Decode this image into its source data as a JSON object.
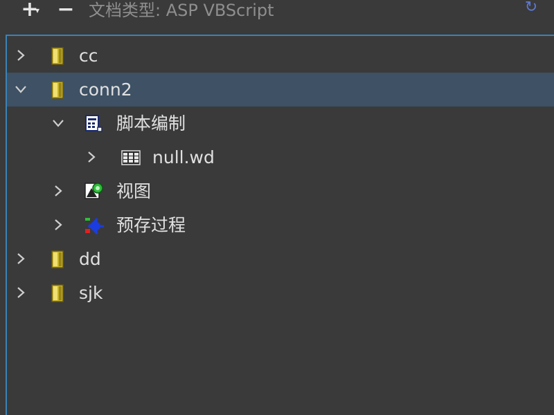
{
  "toolbar": {
    "add_icon": "plus-icon",
    "remove_icon": "minus-icon",
    "doc_type_label": "文档类型: ASP VBScript",
    "refresh_icon": "refresh-icon",
    "accent": "#3a83b8"
  },
  "tree": {
    "items": [
      {
        "label": "cc",
        "icon": "database-icon",
        "expanded": false,
        "level": 0
      },
      {
        "label": "conn2",
        "icon": "database-icon",
        "expanded": true,
        "selected": true,
        "level": 0
      },
      {
        "label": "脚本编制",
        "icon": "script-icon",
        "expanded": true,
        "level": 1
      },
      {
        "label": "null.wd",
        "icon": "table-icon",
        "expanded": false,
        "level": 2
      },
      {
        "label": "视图",
        "icon": "view-icon",
        "expanded": false,
        "level": 1
      },
      {
        "label": "预存过程",
        "icon": "stored-procedure-icon",
        "expanded": false,
        "level": 1
      },
      {
        "label": "dd",
        "icon": "database-icon",
        "expanded": false,
        "level": 0
      },
      {
        "label": "sjk",
        "icon": "database-icon",
        "expanded": false,
        "level": 0
      }
    ],
    "selected_color": "#3e5165"
  }
}
